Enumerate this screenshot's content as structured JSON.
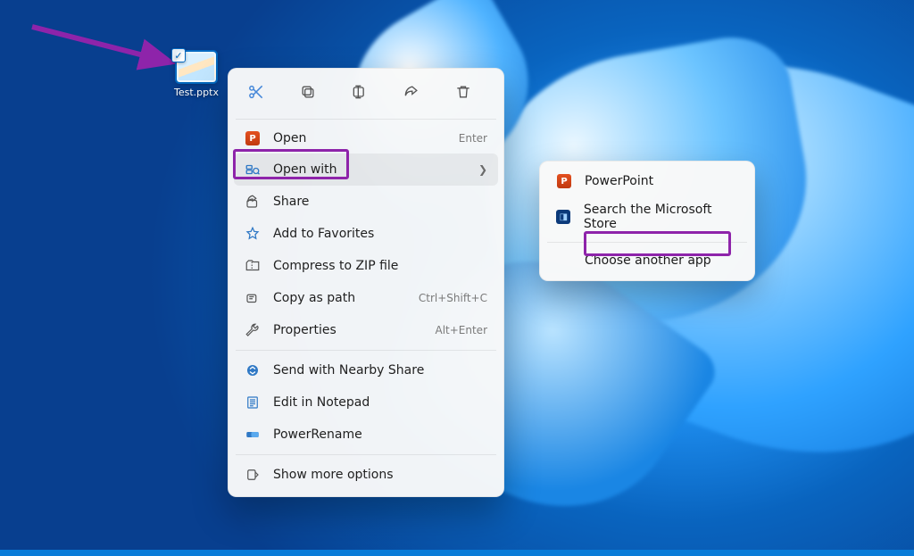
{
  "desktop_icon": {
    "filename": "Test.pptx"
  },
  "context_menu": {
    "open": {
      "label": "Open",
      "hint": "Enter"
    },
    "open_with": {
      "label": "Open with"
    },
    "share": {
      "label": "Share"
    },
    "favorites": {
      "label": "Add to Favorites"
    },
    "compress": {
      "label": "Compress to ZIP file"
    },
    "copy_path": {
      "label": "Copy as path",
      "hint": "Ctrl+Shift+C"
    },
    "properties": {
      "label": "Properties",
      "hint": "Alt+Enter"
    },
    "nearby_share": {
      "label": "Send with Nearby Share"
    },
    "notepad": {
      "label": "Edit in Notepad"
    },
    "powerrename": {
      "label": "PowerRename"
    },
    "more_options": {
      "label": "Show more options"
    }
  },
  "submenu": {
    "powerpoint": {
      "label": "PowerPoint"
    },
    "store": {
      "label": "Search the Microsoft Store"
    },
    "choose_other": {
      "label": "Choose another app"
    }
  }
}
